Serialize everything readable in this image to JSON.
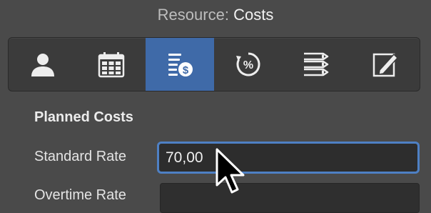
{
  "window": {
    "title_prefix": "Resource:",
    "title_subject": "Costs"
  },
  "toolbar": {
    "tabs": [
      {
        "icon": "person-icon",
        "active": false
      },
      {
        "icon": "calendar-icon",
        "active": false
      },
      {
        "icon": "costs-icon",
        "active": true
      },
      {
        "icon": "percent-cycle-icon",
        "active": false
      },
      {
        "icon": "list-icon",
        "active": false
      },
      {
        "icon": "edit-note-icon",
        "active": false
      }
    ],
    "active_color": "#3f6aa8"
  },
  "planned_costs": {
    "section_title": "Planned Costs",
    "standard_rate": {
      "label": "Standard Rate",
      "value": "70,00"
    },
    "overtime_rate": {
      "label": "Overtime Rate",
      "value": ""
    }
  }
}
